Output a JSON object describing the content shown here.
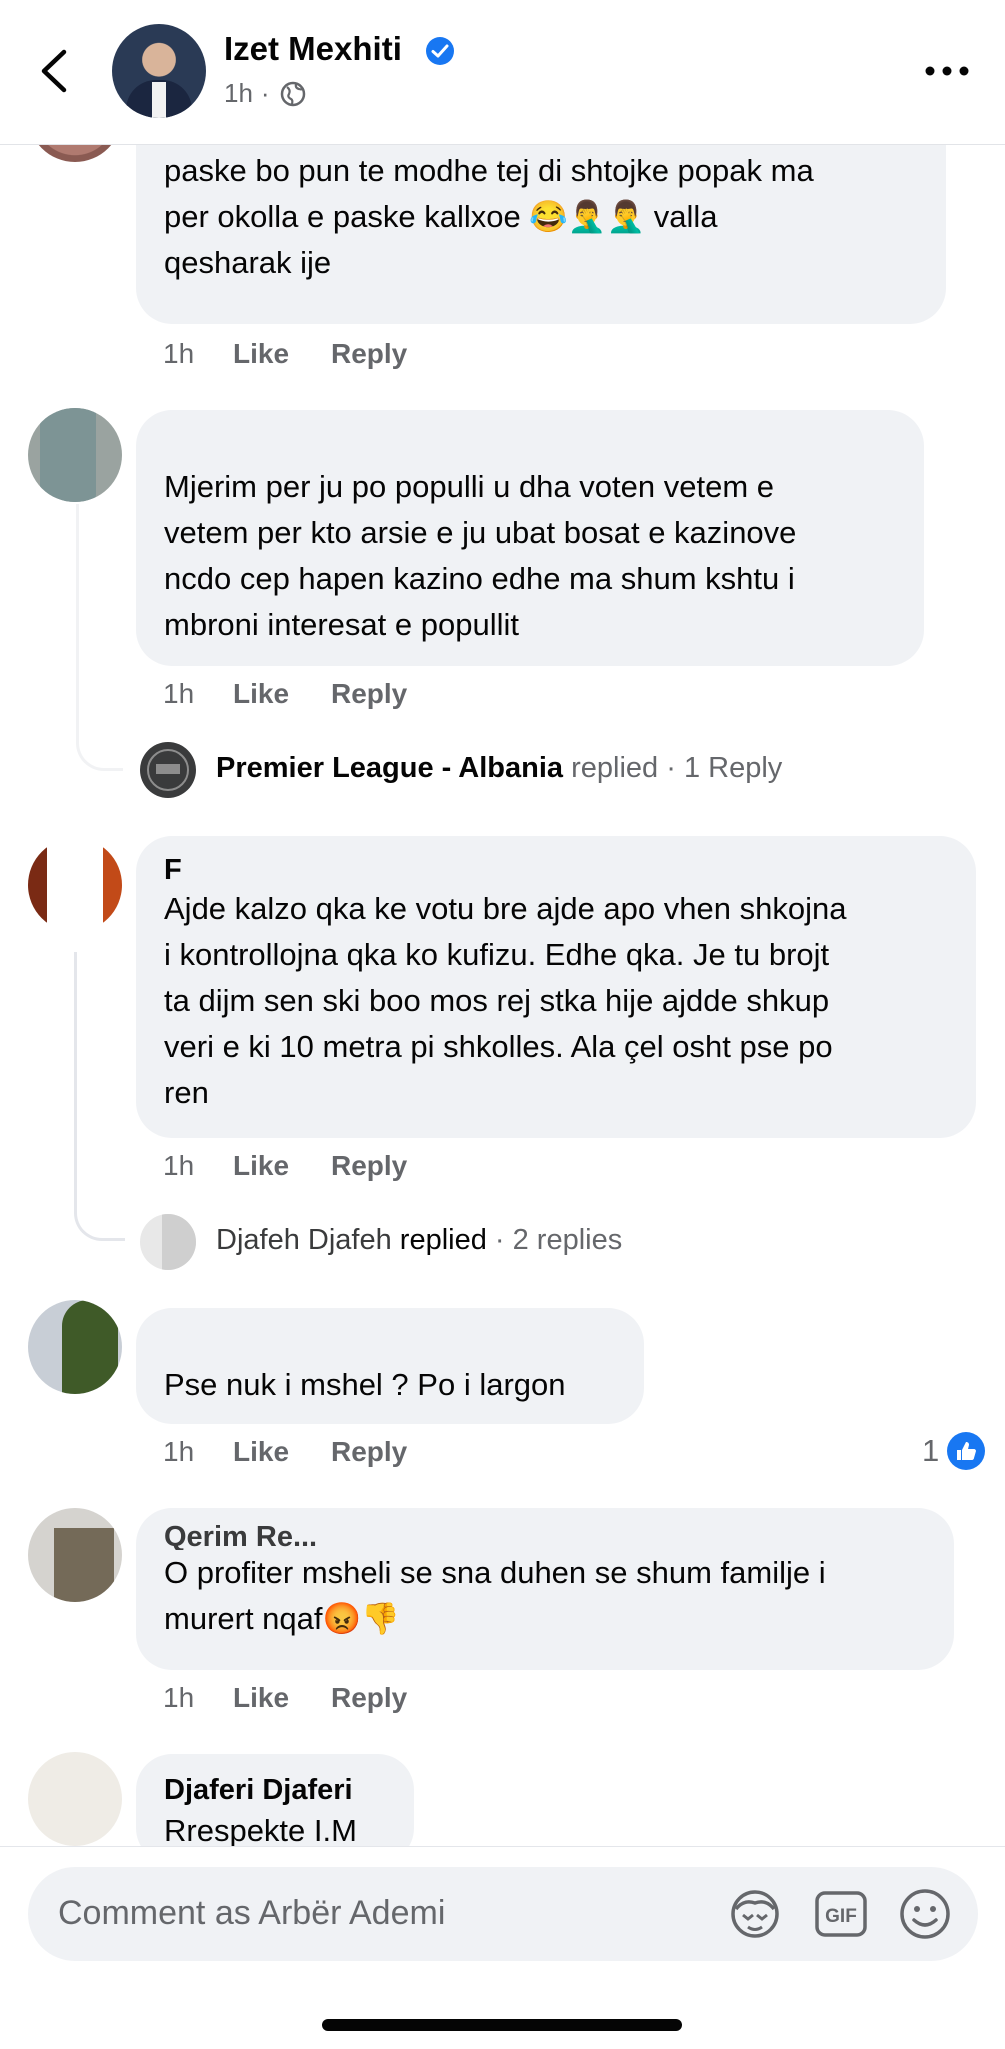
{
  "header": {
    "name": "Izet Mexhiti",
    "time": "1h",
    "dot": "·"
  },
  "comments": [
    {
      "text": "Abe un kurse i ke mshel per pak ta bej like se\npaske bo pun te modhe tej di shtojke popak ma\nper okolla e paske kallxoe 😂🤦‍♂️🤦‍♂️ valla\nqesharak ije",
      "time": "1h",
      "like": "Like",
      "reply": "Reply"
    },
    {
      "text": "Mjerim per ju po populli u dha voten vetem e\nvetem per kto arsie e ju ubat bosat e kazinove\nncdo cep hapen kazino edhe ma shum kshtu i\nmbroni interesat e popullit",
      "time": "1h",
      "like": "Like",
      "reply": "Reply",
      "replied": {
        "name": "Premier League - Albania",
        "action": "replied",
        "count": "· 1 Reply"
      }
    },
    {
      "author": "F",
      "text": "Ajde kalzo qka ke votu bre ajde apo vhen shkojna\ni kontrollojna qka ko kufizu. Edhe qka. Je tu brojt\nta dijm sen ski boo mos rej stka hije  ajdde shkup\nveri e ki 10 metra pi shkolles. Ala çel osht  pse po\nren",
      "time": "1h",
      "like": "Like",
      "reply": "Reply",
      "replied": {
        "name": "Djafeh Djafeh",
        "action": "replied",
        "count": "· 2 replies"
      }
    },
    {
      "text": "Pse nuk i mshel ? Po i largon",
      "time": "1h",
      "like": "Like",
      "reply": "Reply",
      "reactions": "1"
    },
    {
      "author": "Qerim Re...",
      "text": "O profiter msheli se sna duhen se shum familje i\nmurert nqaf😡👎",
      "time": "1h",
      "like": "Like",
      "reply": "Reply"
    },
    {
      "author": "Djaferi Djaferi",
      "text": "Rrespekte I.M"
    }
  ],
  "composer": {
    "placeholder": "Comment as Arbër Ademi"
  },
  "icons": [
    "back-arrow-icon",
    "verified-badge-icon",
    "globe-icon",
    "more-icon",
    "avatar-sticker-icon",
    "gif-icon",
    "emoji-icon",
    "thumbs-up-icon"
  ],
  "colors": {
    "accent": "#1877f2",
    "bubble": "#f0f2f5",
    "secondary_text": "#65676b"
  }
}
